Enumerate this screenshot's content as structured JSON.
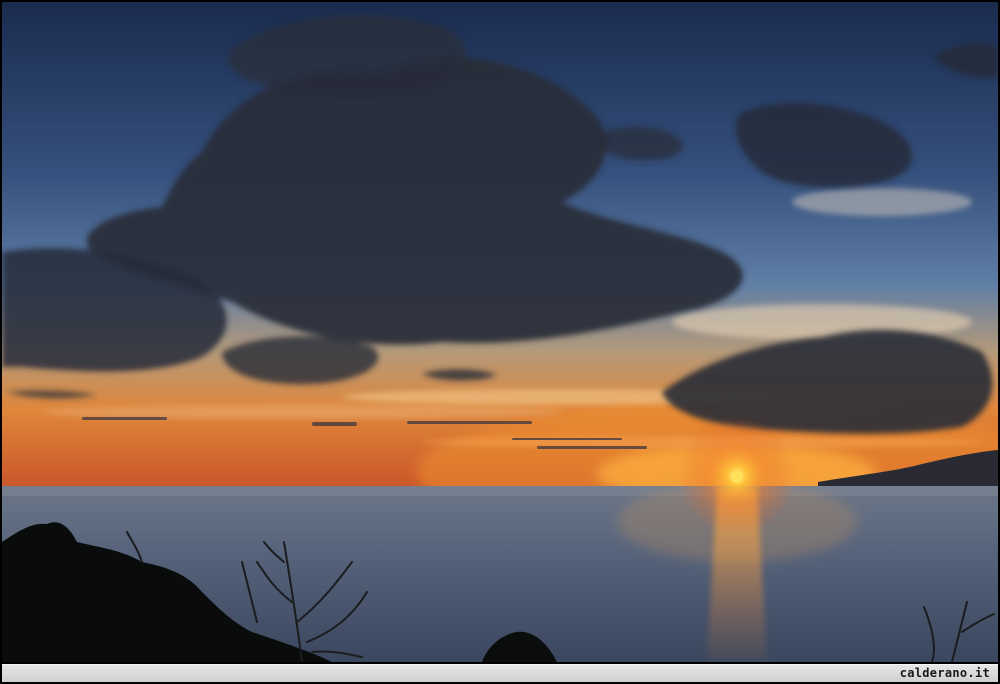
{
  "photo": {
    "subject": "sunset-over-sea",
    "colors": {
      "sky_top": "#1c2f55",
      "sky_mid": "#4a6d9c",
      "horizon_glow": "#f08a2a",
      "sun": "#ffd23a",
      "sea": "#5a6a80",
      "cloud_dark": "#262b36",
      "foreground": "#0a0c0c"
    }
  },
  "caption": {
    "watermark": "calderano.it"
  }
}
